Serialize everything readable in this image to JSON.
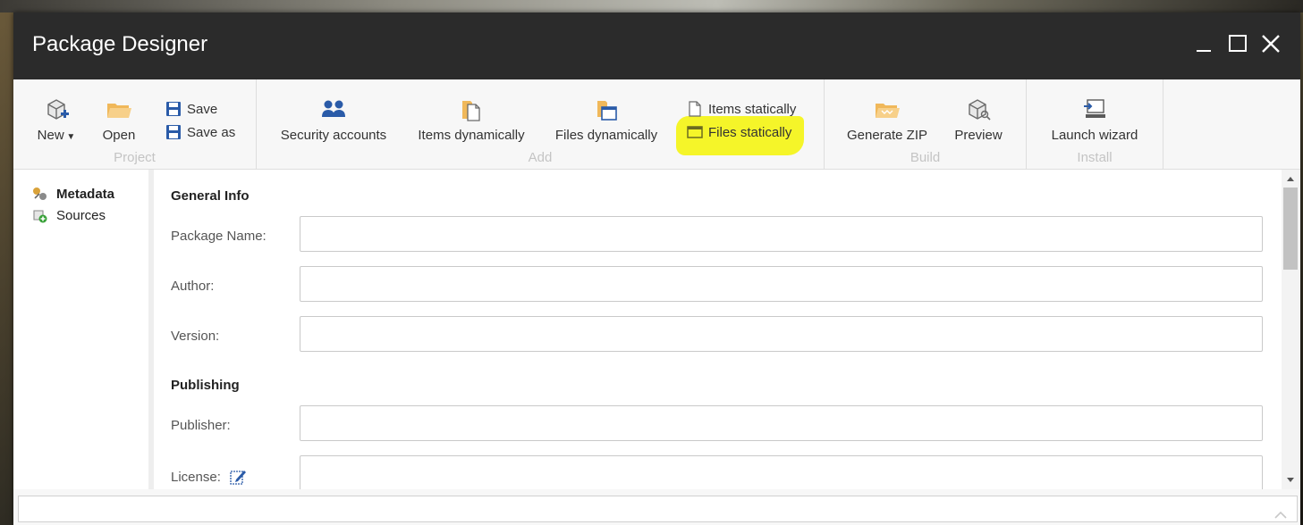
{
  "window": {
    "title": "Package Designer"
  },
  "ribbon": {
    "project": {
      "label": "Project",
      "new_label": "New",
      "open_label": "Open",
      "save_label": "Save",
      "save_as_label": "Save as"
    },
    "add": {
      "label": "Add",
      "security_accounts_label": "Security accounts",
      "items_dynamically_label": "Items dynamically",
      "files_dynamically_label": "Files dynamically",
      "items_statically_label": "Items statically",
      "files_statically_label": "Files statically"
    },
    "build": {
      "label": "Build",
      "generate_zip_label": "Generate ZIP",
      "preview_label": "Preview"
    },
    "install": {
      "label": "Install",
      "launch_wizard_label": "Launch wizard"
    }
  },
  "sidebar": {
    "items": [
      {
        "label": "Metadata",
        "selected": true
      },
      {
        "label": "Sources",
        "selected": false
      }
    ]
  },
  "form": {
    "general_info": {
      "heading": "General Info",
      "package_name_label": "Package Name:",
      "package_name_value": "",
      "author_label": "Author:",
      "author_value": "",
      "version_label": "Version:",
      "version_value": ""
    },
    "publishing": {
      "heading": "Publishing",
      "publisher_label": "Publisher:",
      "publisher_value": "",
      "license_label": "License:",
      "license_value": ""
    }
  },
  "colors": {
    "titlebar": "#2b2b2b",
    "highlight": "#f4f41e",
    "ribbon_bg": "#f7f7f7",
    "icon_blue": "#2a5ba8",
    "icon_orange": "#f0b85a"
  }
}
